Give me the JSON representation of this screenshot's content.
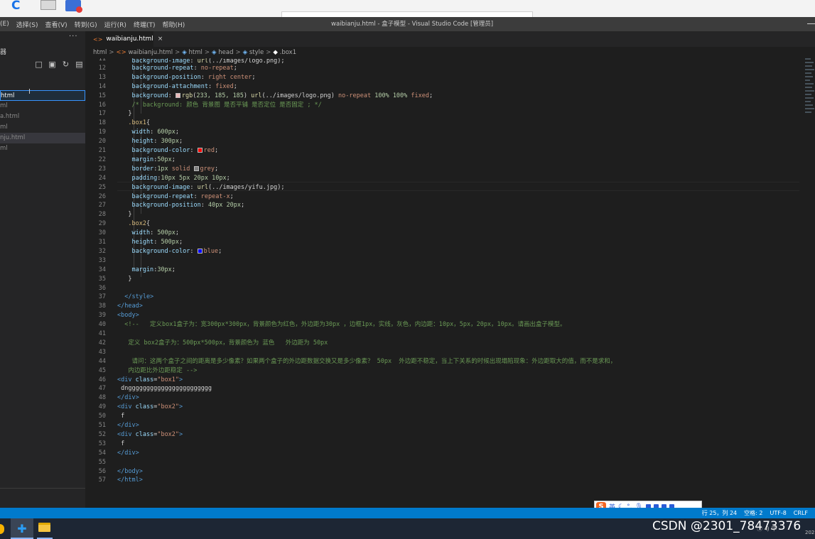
{
  "window": {
    "title": "waibianju.html - 盒子模型 - Visual Studio Code [管理员]"
  },
  "menubar": {
    "items": [
      "(E)",
      "选择(S)",
      "查看(V)",
      "转到(G)",
      "运行(R)",
      "终端(T)",
      "帮助(H)"
    ]
  },
  "sidebar": {
    "header_glyph": "器",
    "more_label": "···",
    "files": [
      "html",
      "ml",
      "a.html",
      "ml",
      "nju.html",
      "ml"
    ]
  },
  "tab": {
    "label": "waibianju.html",
    "close": "×"
  },
  "breadcrumb": {
    "items": [
      "html",
      "waibianju.html",
      "html",
      "head",
      "style",
      ".box1"
    ]
  },
  "editor": {
    "line_numbers": [
      "11",
      "12",
      "13",
      "14",
      "15",
      "16",
      "17",
      "18",
      "19",
      "20",
      "21",
      "22",
      "23",
      "24",
      "25",
      "26",
      "27",
      "28",
      "29",
      "30",
      "31",
      "32",
      "33",
      "34",
      "35",
      "36",
      "37",
      "38",
      "39",
      "40",
      "41",
      "42",
      "43",
      "44",
      "45",
      "46",
      "47",
      "48",
      "49",
      "50",
      "51",
      "52",
      "53",
      "54",
      "55",
      "56",
      "57"
    ],
    "lines": [
      "background-image: url(../images/logo.png);",
      "background-repeat: no-repeat;",
      "background-position: right center;",
      "background-attachment: fixed;",
      "background: rgb(233, 185, 185) url(../images/logo.png) no-repeat 100% 100% fixed;",
      "/* background: 颜色 背景图 是否平铺 是否定位 是否固定 ; */",
      "}",
      ".box1{",
      "width: 600px;",
      "height: 300px;",
      "background-color: red;",
      "margin:50px;",
      "border:1px solid grey;",
      "padding:10px 5px 20px 10px;",
      "background-image: url(../images/yifu.jpg);",
      "background-repeat: repeat-x;",
      "background-position: 40px 20px;",
      "}",
      ".box2{",
      "width: 500px;",
      "height: 500px;",
      "background-color: blue;",
      "",
      "margin:30px;",
      "}",
      "",
      "</style>",
      "</head>",
      "<body>",
      "<!--   定义box1盒子为：宽300px*300px，背景颜色为红色，外边距为30px ，边框1px，实线，灰色，内边距：10px，5px，20px，10px。请画出盒子模型。",
      "",
      "定义 box2盒子为：500px*500px，背景颜色为 蓝色   外边距为 50px",
      "",
      "请问：这两个盒子之间的距离是多少像素？如果两个盒子的外边距数据交换又是多少像素？ 50px  外边距不稳定，当上下关系的时候出现塌陷现象：外边距取大的值，而不是求和，",
      "内边距比外边距稳定 -->",
      "<div class=\"box1\">",
      "dnggggggggggggggggggggggg",
      "</div>",
      "<div class=\"box2\">",
      "f",
      "</div>",
      "<div class=\"box2\">",
      "f",
      "</div>",
      "",
      "</body>",
      "</html>"
    ]
  },
  "statusbar": {
    "position": "行 25，列 24",
    "spaces": "空格: 2",
    "encoding": "UTF-8",
    "eol": "CRLF"
  },
  "ime": {
    "mode": "英",
    "logo": "S"
  },
  "taskbar": {
    "watermark": "CSDN @2301_78473376",
    "tray": "ⓘ ◂) 中",
    "clock": "202"
  },
  "colors": {
    "swatch_rgb": "#e9b9b9",
    "swatch_red": "#ff0000",
    "swatch_grey": "#808080",
    "swatch_blue": "#0000ff",
    "accent": "#007acc"
  }
}
